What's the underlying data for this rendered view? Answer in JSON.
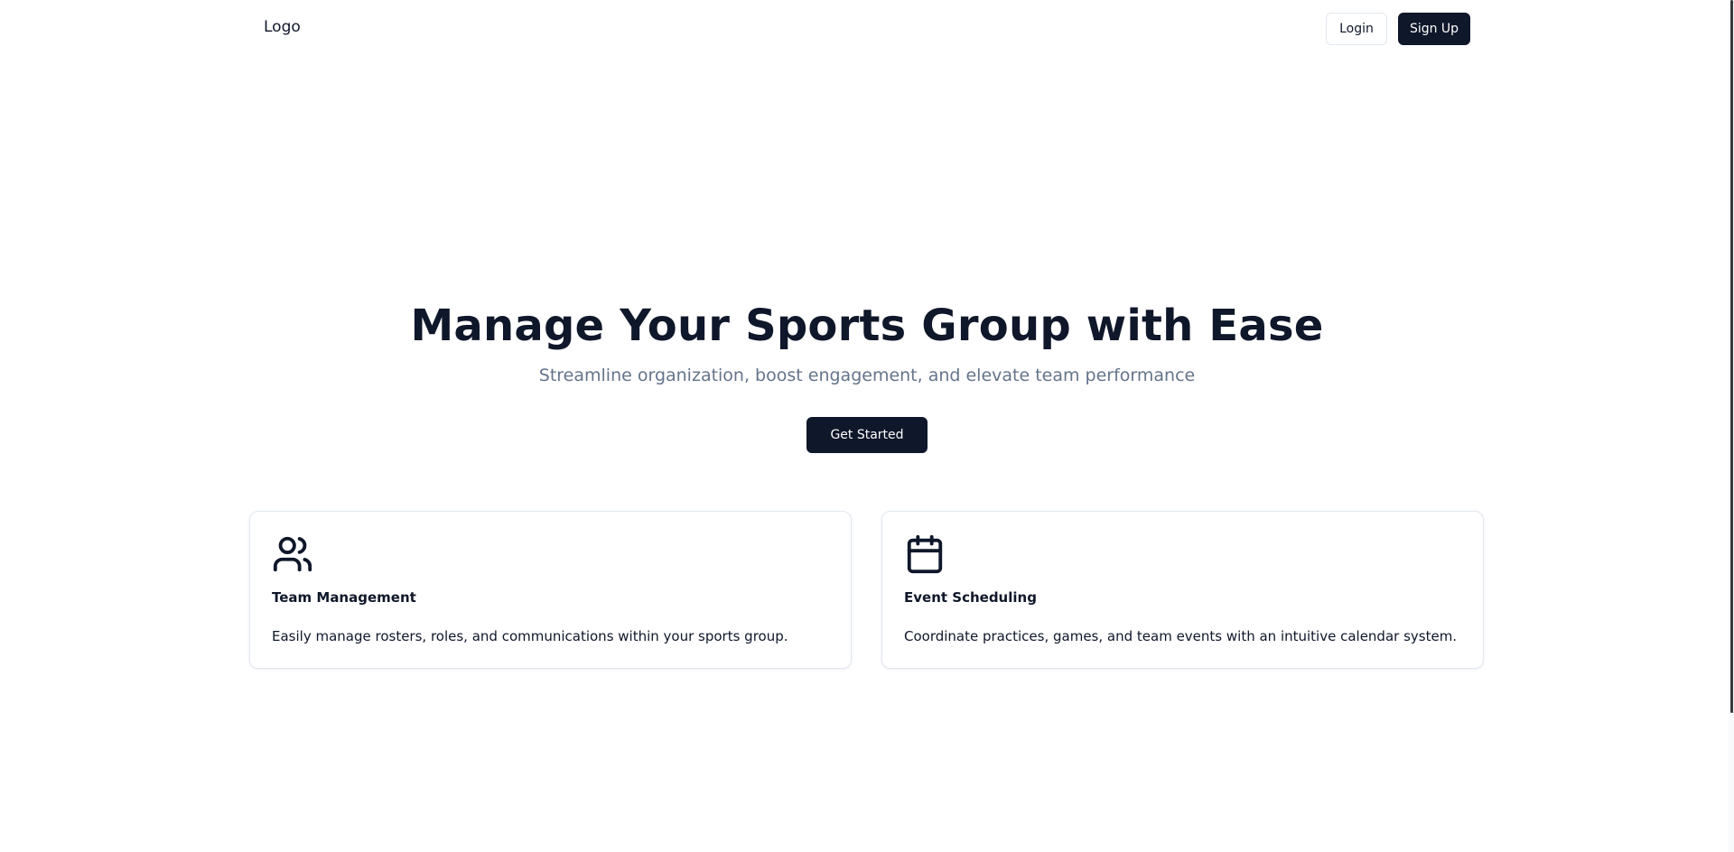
{
  "header": {
    "logo_text": "Logo",
    "login_label": "Login",
    "signup_label": "Sign Up"
  },
  "hero": {
    "title": "Manage Your Sports Group with Ease",
    "subtitle": "Streamline organization, boost engagement, and elevate team performance",
    "cta_label": "Get Started"
  },
  "features": [
    {
      "icon": "users-icon",
      "title": "Team Management",
      "description": "Easily manage rosters, roles, and communications within your sports group."
    },
    {
      "icon": "calendar-icon",
      "title": "Event Scheduling",
      "description": "Coordinate practices, games, and team events with an intuitive calendar system."
    }
  ],
  "colors": {
    "primary": "#0f172a",
    "muted_text": "#64748b",
    "border": "#e2e8f0",
    "background": "#ffffff"
  }
}
